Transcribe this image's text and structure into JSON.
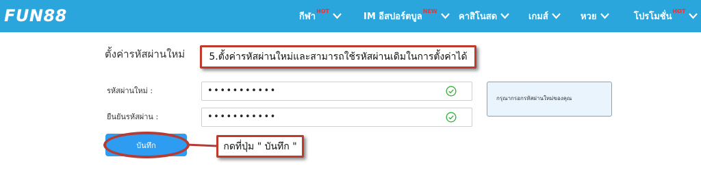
{
  "header": {
    "logo": "FUN88",
    "nav": [
      {
        "label": "กีฬา",
        "badge": "HOT"
      },
      {
        "label": "IM อีสปอร์ตบูล",
        "badge": "NEW"
      },
      {
        "label": "คาสิโนสด",
        "badge": ""
      },
      {
        "label": "เกมส์",
        "badge": ""
      },
      {
        "label": "หวย",
        "badge": ""
      },
      {
        "label": "โปรโมชั่น",
        "badge": "HOT"
      }
    ]
  },
  "page": {
    "title": "ตั้งค่ารหัสผ่านใหม่"
  },
  "form": {
    "new_password_label": "รหัสผ่านใหม่ :",
    "new_password_value": "•••••••••••",
    "confirm_password_label": "ยืนยันรหัสผ่าน :",
    "confirm_password_value": "•••••••••••",
    "save_label": "บันทึก"
  },
  "info": {
    "text": "กรุณากรอกรหัสผ่านใหม่ของคุณ"
  },
  "annotations": {
    "step5": "5.ตั้งค่ารหัสผ่านใหม่และสามารถใช้รหัสผ่านเดิมในการตั้งค่าได้",
    "press_save": "กดที่ปุ่ม \" บันทึก \""
  },
  "colors": {
    "header_bg": "#2aa6dd",
    "badge": "#ff2a2a",
    "button": "#2e9cf0",
    "annotation_border": "#c0392b",
    "check": "#3cb043"
  },
  "icons": {
    "nav_chevron": "chevron-down-icon",
    "valid": "check-circle-icon"
  }
}
